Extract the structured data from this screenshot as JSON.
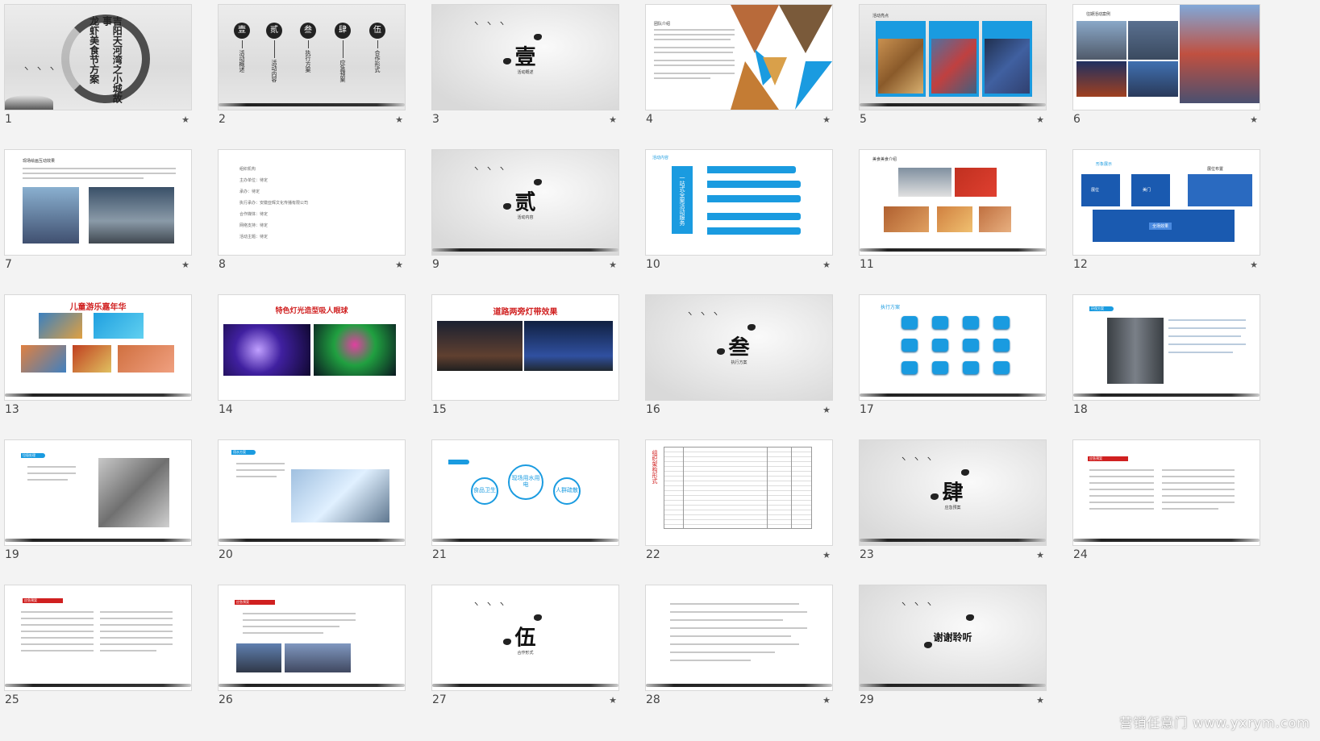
{
  "slides": [
    {
      "num": "1",
      "star": true,
      "title_lines": [
        "吉阳天河湾之小城故事",
        "龙虾美食节方案"
      ]
    },
    {
      "num": "2",
      "star": true,
      "toc": [
        {
          "n": "壹",
          "label": "活动概述"
        },
        {
          "n": "贰",
          "label": "活动内容"
        },
        {
          "n": "叁",
          "label": "执行方案"
        },
        {
          "n": "肆",
          "label": "应急预案"
        },
        {
          "n": "伍",
          "label": "合作形式"
        }
      ]
    },
    {
      "num": "3",
      "star": true,
      "big": "壹",
      "caption": "活动概述"
    },
    {
      "num": "4",
      "star": true,
      "heading": "团队介绍"
    },
    {
      "num": "5",
      "star": true,
      "heading": "活动亮点"
    },
    {
      "num": "6",
      "star": true,
      "heading": "往期活动案例"
    },
    {
      "num": "7",
      "star": true,
      "heading": "现场绘画互动效果"
    },
    {
      "num": "8",
      "star": true,
      "lines": [
        "组织机构",
        "主办单位：待定",
        "承办：待定",
        "执行承办：安徽亚辉文化传播有限公司",
        "合作媒体：待定",
        "网络支持：待定",
        "活动主题：待定"
      ]
    },
    {
      "num": "9",
      "star": true,
      "big": "贰",
      "caption": "活动内容"
    },
    {
      "num": "10",
      "star": true,
      "heading": "活动内容",
      "side_title": "一站式全案活动服务"
    },
    {
      "num": "11",
      "star": true,
      "heading": "美食美食介绍"
    },
    {
      "num": "12",
      "star": true,
      "heading": "形象展示",
      "sub": "展位布置",
      "labels": [
        "展位",
        "美门",
        "全场效果"
      ]
    },
    {
      "num": "13",
      "star": false,
      "red_title": "儿童游乐嘉年华"
    },
    {
      "num": "14",
      "star": false,
      "red_title": "特色灯光造型吸人眼球"
    },
    {
      "num": "15",
      "star": false,
      "red_title": "道路两旁灯带效果"
    },
    {
      "num": "16",
      "star": true,
      "big": "叁",
      "caption": "执行方案"
    },
    {
      "num": "17",
      "star": false,
      "heading": "执行方案"
    },
    {
      "num": "18",
      "star": false,
      "heading": "环保方案"
    },
    {
      "num": "19",
      "star": false,
      "heading": "垃圾处理"
    },
    {
      "num": "20",
      "star": false,
      "heading": "用水方案"
    },
    {
      "num": "21",
      "star": false,
      "bubbles": [
        "食品卫生",
        "现场用水用电",
        "人群疏散"
      ]
    },
    {
      "num": "22",
      "star": true,
      "side_title": "组织架构形式"
    },
    {
      "num": "23",
      "star": true,
      "big": "肆",
      "caption": "应急预案"
    },
    {
      "num": "24",
      "star": false,
      "heading": "应急预案"
    },
    {
      "num": "25",
      "star": false,
      "heading": "应急预案"
    },
    {
      "num": "26",
      "star": false,
      "heading": "应急预案"
    },
    {
      "num": "27",
      "star": true,
      "big": "伍",
      "caption": "合作形式"
    },
    {
      "num": "28",
      "star": true
    },
    {
      "num": "29",
      "star": true,
      "big": "谢谢聆听"
    }
  ],
  "star_glyph": "★",
  "birds": "ヽ ヽ ヽ",
  "watermark": "营销任意门 www.yxrym.com",
  "colors": {
    "accent": "#1a9be0",
    "red": "#d02020",
    "ink": "#222222"
  }
}
